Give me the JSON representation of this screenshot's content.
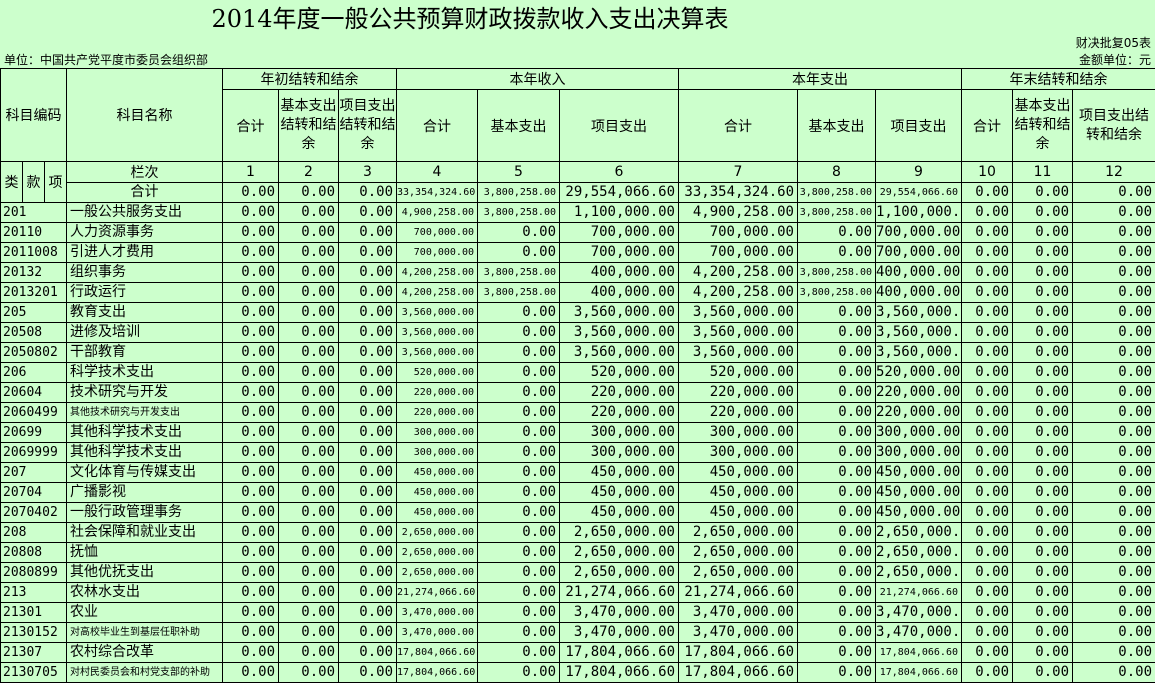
{
  "title": "2014年度一般公共预算财政拨款收入支出决算表",
  "form_code": "财决批复05表",
  "unit_left": "单位：中国共产党平度市委员会组织部",
  "unit_right": "金额单位：元",
  "headers": {
    "subject_code": "科目编码",
    "subject_name": "科目名称",
    "group_begin": "年初结转和结余",
    "group_income": "本年收入",
    "group_expend": "本年支出",
    "group_end": "年末结转和结余",
    "total": "合计",
    "basic_carry": "基本支出结转和结余",
    "project_carry": "项目支出结转和结余",
    "basic_exp": "基本支出",
    "project_exp": "项目支出",
    "project_carry_end": "项目支出结转和结余",
    "lei": "类",
    "kuan": "款",
    "xiang": "项",
    "lanci": "栏次",
    "col_numbers": [
      "1",
      "2",
      "3",
      "4",
      "5",
      "6",
      "7",
      "8",
      "9",
      "10",
      "11",
      "12"
    ]
  },
  "total_row": {
    "label": "合计",
    "values": [
      "0.00",
      "0.00",
      "0.00",
      "33,354,324.60",
      "3,800,258.00",
      "29,554,066.60",
      "33,354,324.60",
      "3,800,258.00",
      "29,554,066.60",
      "0.00",
      "0.00",
      "0.00"
    ]
  },
  "rows": [
    {
      "code": "201",
      "name": "一般公共服务支出",
      "indent": 0,
      "values": [
        "0.00",
        "0.00",
        "0.00",
        "4,900,258.00",
        "3,800,258.00",
        "1,100,000.00",
        "4,900,258.00",
        "3,800,258.00",
        "1,100,000.00",
        "0.00",
        "0.00",
        "0.00"
      ]
    },
    {
      "code": "20110",
      "name": "人力资源事务",
      "indent": 0,
      "values": [
        "0.00",
        "0.00",
        "0.00",
        "700,000.00",
        "0.00",
        "700,000.00",
        "700,000.00",
        "0.00",
        "700,000.00",
        "0.00",
        "0.00",
        "0.00"
      ]
    },
    {
      "code": "2011008",
      "name": "引进人才费用",
      "indent": 1,
      "values": [
        "0.00",
        "0.00",
        "0.00",
        "700,000.00",
        "0.00",
        "700,000.00",
        "700,000.00",
        "0.00",
        "700,000.00",
        "0.00",
        "0.00",
        "0.00"
      ]
    },
    {
      "code": "20132",
      "name": "组织事务",
      "indent": 0,
      "values": [
        "0.00",
        "0.00",
        "0.00",
        "4,200,258.00",
        "3,800,258.00",
        "400,000.00",
        "4,200,258.00",
        "3,800,258.00",
        "400,000.00",
        "0.00",
        "0.00",
        "0.00"
      ]
    },
    {
      "code": "2013201",
      "name": "行政运行",
      "indent": 2,
      "values": [
        "0.00",
        "0.00",
        "0.00",
        "4,200,258.00",
        "3,800,258.00",
        "400,000.00",
        "4,200,258.00",
        "3,800,258.00",
        "400,000.00",
        "0.00",
        "0.00",
        "0.00"
      ]
    },
    {
      "code": "205",
      "name": "教育支出",
      "indent": 0,
      "values": [
        "0.00",
        "0.00",
        "0.00",
        "3,560,000.00",
        "0.00",
        "3,560,000.00",
        "3,560,000.00",
        "0.00",
        "3,560,000.00",
        "0.00",
        "0.00",
        "0.00"
      ]
    },
    {
      "code": "20508",
      "name": "进修及培训",
      "indent": 0,
      "values": [
        "0.00",
        "0.00",
        "0.00",
        "3,560,000.00",
        "0.00",
        "3,560,000.00",
        "3,560,000.00",
        "0.00",
        "3,560,000.00",
        "0.00",
        "0.00",
        "0.00"
      ]
    },
    {
      "code": "2050802",
      "name": "干部教育",
      "indent": 2,
      "values": [
        "0.00",
        "0.00",
        "0.00",
        "3,560,000.00",
        "0.00",
        "3,560,000.00",
        "3,560,000.00",
        "0.00",
        "3,560,000.00",
        "0.00",
        "0.00",
        "0.00"
      ]
    },
    {
      "code": "206",
      "name": "科学技术支出",
      "indent": 0,
      "values": [
        "0.00",
        "0.00",
        "0.00",
        "520,000.00",
        "0.00",
        "520,000.00",
        "520,000.00",
        "0.00",
        "520,000.00",
        "0.00",
        "0.00",
        "0.00"
      ]
    },
    {
      "code": "20604",
      "name": "技术研究与开发",
      "indent": 0,
      "values": [
        "0.00",
        "0.00",
        "0.00",
        "220,000.00",
        "0.00",
        "220,000.00",
        "220,000.00",
        "0.00",
        "220,000.00",
        "0.00",
        "0.00",
        "0.00"
      ]
    },
    {
      "code": "2060499",
      "name": "其他技术研究与开发支出",
      "indent": 1,
      "small": true,
      "values": [
        "0.00",
        "0.00",
        "0.00",
        "220,000.00",
        "0.00",
        "220,000.00",
        "220,000.00",
        "0.00",
        "220,000.00",
        "0.00",
        "0.00",
        "0.00"
      ]
    },
    {
      "code": "20699",
      "name": "其他科学技术支出",
      "indent": 0,
      "values": [
        "0.00",
        "0.00",
        "0.00",
        "300,000.00",
        "0.00",
        "300,000.00",
        "300,000.00",
        "0.00",
        "300,000.00",
        "0.00",
        "0.00",
        "0.00"
      ]
    },
    {
      "code": "2069999",
      "name": "其他科学技术支出",
      "indent": 1,
      "values": [
        "0.00",
        "0.00",
        "0.00",
        "300,000.00",
        "0.00",
        "300,000.00",
        "300,000.00",
        "0.00",
        "300,000.00",
        "0.00",
        "0.00",
        "0.00"
      ]
    },
    {
      "code": "207",
      "name": "文化体育与传媒支出",
      "indent": 0,
      "values": [
        "0.00",
        "0.00",
        "0.00",
        "450,000.00",
        "0.00",
        "450,000.00",
        "450,000.00",
        "0.00",
        "450,000.00",
        "0.00",
        "0.00",
        "0.00"
      ]
    },
    {
      "code": "20704",
      "name": "广播影视",
      "indent": 0,
      "values": [
        "0.00",
        "0.00",
        "0.00",
        "450,000.00",
        "0.00",
        "450,000.00",
        "450,000.00",
        "0.00",
        "450,000.00",
        "0.00",
        "0.00",
        "0.00"
      ]
    },
    {
      "code": "2070402",
      "name": "一般行政管理事务",
      "indent": 1,
      "values": [
        "0.00",
        "0.00",
        "0.00",
        "450,000.00",
        "0.00",
        "450,000.00",
        "450,000.00",
        "0.00",
        "450,000.00",
        "0.00",
        "0.00",
        "0.00"
      ]
    },
    {
      "code": "208",
      "name": "社会保障和就业支出",
      "indent": 0,
      "values": [
        "0.00",
        "0.00",
        "0.00",
        "2,650,000.00",
        "0.00",
        "2,650,000.00",
        "2,650,000.00",
        "0.00",
        "2,650,000.00",
        "0.00",
        "0.00",
        "0.00"
      ]
    },
    {
      "code": "20808",
      "name": "抚恤",
      "indent": 0,
      "values": [
        "0.00",
        "0.00",
        "0.00",
        "2,650,000.00",
        "0.00",
        "2,650,000.00",
        "2,650,000.00",
        "0.00",
        "2,650,000.00",
        "0.00",
        "0.00",
        "0.00"
      ]
    },
    {
      "code": "2080899",
      "name": "其他优抚支出",
      "indent": 1,
      "values": [
        "0.00",
        "0.00",
        "0.00",
        "2,650,000.00",
        "0.00",
        "2,650,000.00",
        "2,650,000.00",
        "0.00",
        "2,650,000.00",
        "0.00",
        "0.00",
        "0.00"
      ]
    },
    {
      "code": "213",
      "name": "农林水支出",
      "indent": 0,
      "values": [
        "0.00",
        "0.00",
        "0.00",
        "21,274,066.60",
        "0.00",
        "21,274,066.60",
        "21,274,066.60",
        "0.00",
        "21,274,066.60",
        "0.00",
        "0.00",
        "0.00"
      ]
    },
    {
      "code": "21301",
      "name": "农业",
      "indent": 0,
      "values": [
        "0.00",
        "0.00",
        "0.00",
        "3,470,000.00",
        "0.00",
        "3,470,000.00",
        "3,470,000.00",
        "0.00",
        "3,470,000.00",
        "0.00",
        "0.00",
        "0.00"
      ]
    },
    {
      "code": "2130152",
      "name": "对高校毕业生到基层任职补助",
      "indent": 1,
      "small": true,
      "values": [
        "0.00",
        "0.00",
        "0.00",
        "3,470,000.00",
        "0.00",
        "3,470,000.00",
        "3,470,000.00",
        "0.00",
        "3,470,000.00",
        "0.00",
        "0.00",
        "0.00"
      ]
    },
    {
      "code": "21307",
      "name": "农村综合改革",
      "indent": 0,
      "values": [
        "0.00",
        "0.00",
        "0.00",
        "17,804,066.60",
        "0.00",
        "17,804,066.60",
        "17,804,066.60",
        "0.00",
        "17,804,066.60",
        "0.00",
        "0.00",
        "0.00"
      ]
    },
    {
      "code": "2130705",
      "name": "对村民委员会和村党支部的补助",
      "indent": 1,
      "small": true,
      "values": [
        "0.00",
        "0.00",
        "0.00",
        "17,804,066.60",
        "0.00",
        "17,804,066.60",
        "17,804,066.60",
        "0.00",
        "17,804,066.60",
        "0.00",
        "0.00",
        "0.00"
      ]
    }
  ]
}
